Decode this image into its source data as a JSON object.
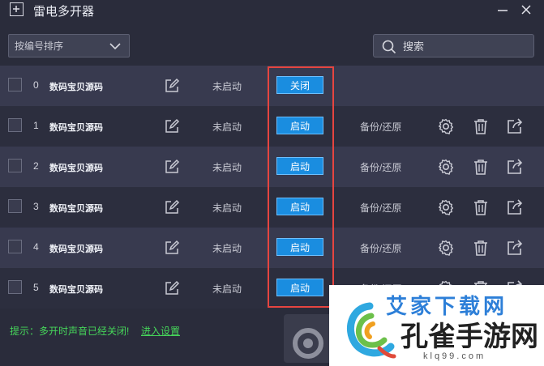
{
  "window": {
    "title": "雷电多开器",
    "minimize_icon": "minimize-icon",
    "close_icon": "close-icon"
  },
  "toolbar": {
    "sort_selected": "按编号排序",
    "search_placeholder": "搜索"
  },
  "rows": [
    {
      "index": "0",
      "name": "数码宝贝源码",
      "status": "未启动",
      "action": "关闭",
      "backup": ""
    },
    {
      "index": "1",
      "name": "数码宝贝源码",
      "status": "未启动",
      "action": "启动",
      "backup": "备份/还原"
    },
    {
      "index": "2",
      "name": "数码宝贝源码",
      "status": "未启动",
      "action": "启动",
      "backup": "备份/还原"
    },
    {
      "index": "3",
      "name": "数码宝贝源码",
      "status": "未启动",
      "action": "启动",
      "backup": "备份/还原"
    },
    {
      "index": "4",
      "name": "数码宝贝源码",
      "status": "未启动",
      "action": "启动",
      "backup": "备份/还原"
    },
    {
      "index": "5",
      "name": "数码宝贝源码",
      "status": "未启动",
      "action": "启动",
      "backup": "备份/还原"
    }
  ],
  "footer": {
    "tip": "提示：多开时声音已经关闭!",
    "tip_link": "进入设置"
  },
  "watermark": {
    "top_text": "艾家下载网",
    "main_text": "孔雀手游网",
    "sub_text": "klq99.com"
  },
  "colors": {
    "background": "#2a2c3b",
    "accent_button": "#1a8de0",
    "highlight_box": "#e64540",
    "tip_text": "#46d65a"
  }
}
